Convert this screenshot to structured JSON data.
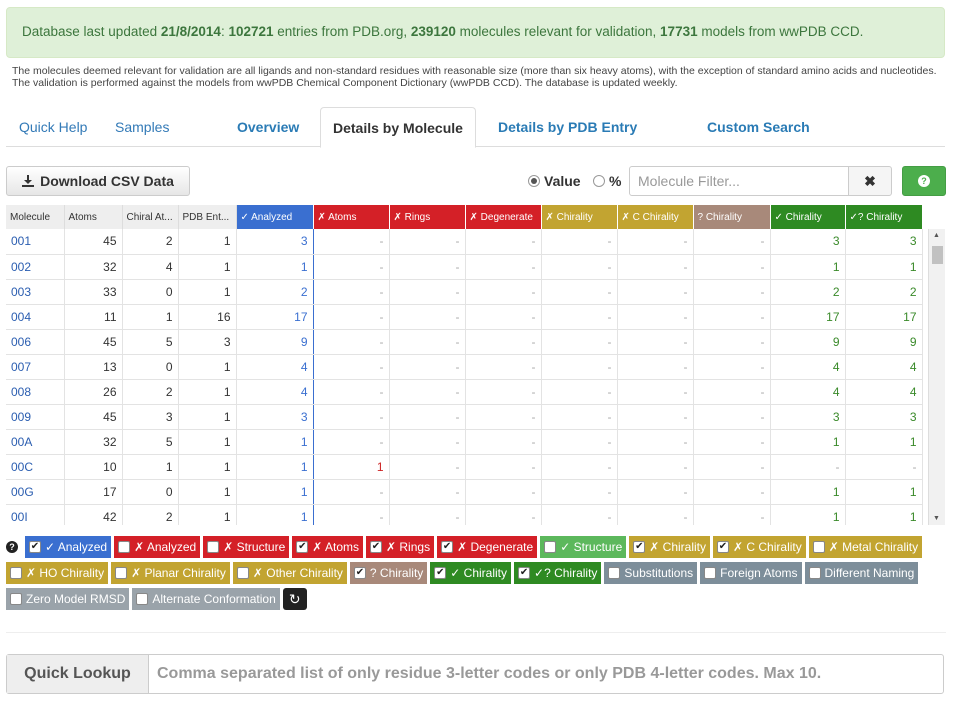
{
  "banner": {
    "prefix": "Database last updated",
    "date": "21/8/2014",
    "entries": "102721",
    "entries_text": "entries from PDB.org,",
    "molecules": "239120",
    "molecules_text": "molecules relevant for validation,",
    "models": "17731",
    "models_text": "models from wwPDB CCD."
  },
  "note": "The molecules deemed relevant for validation are all ligands and non-standard residues with reasonable size (more than six heavy atoms), with the exception of standard amino acids and nucleotides. The validation is performed against the models from wwPDB Chemical Component Dictionary (wwPDB CCD). The database is updated weekly.",
  "tabs": [
    "Quick Help",
    "Samples",
    "Overview",
    "Details by Molecule",
    "Details by PDB Entry",
    "Custom Search"
  ],
  "toolbar": {
    "download_label": "Download CSV Data",
    "value_label": "Value",
    "percent_label": "%",
    "filter_placeholder": "Molecule Filter..."
  },
  "colors": {
    "analyzed": "#3a6fd0",
    "red": "#d42027",
    "gold": "#c2a431",
    "brown": "#a8897a",
    "green": "#2e8a22",
    "slate": "#7d8e9a"
  },
  "columns": [
    {
      "label": "Molecule",
      "style": "plain"
    },
    {
      "label": "Atoms",
      "style": "plain"
    },
    {
      "label": "Chiral At...",
      "style": "plain"
    },
    {
      "label": "PDB Ent...",
      "style": "plain"
    },
    {
      "label": "✓ Analyzed",
      "style": "analyzed"
    },
    {
      "label": "✗ Atoms",
      "style": "red"
    },
    {
      "label": "✗ Rings",
      "style": "red"
    },
    {
      "label": "✗ Degenerate",
      "style": "red"
    },
    {
      "label": "✗ Chirality",
      "style": "gold"
    },
    {
      "label": "✗ C Chirality",
      "style": "gold"
    },
    {
      "label": "? Chirality",
      "style": "brown"
    },
    {
      "label": "✓ Chirality",
      "style": "green"
    },
    {
      "label": "✓? Chirality",
      "style": "green"
    }
  ],
  "rows": [
    [
      "001",
      "45",
      "2",
      "1",
      "3",
      "-",
      "-",
      "-",
      "-",
      "-",
      "-",
      "3",
      "3"
    ],
    [
      "002",
      "32",
      "4",
      "1",
      "1",
      "-",
      "-",
      "-",
      "-",
      "-",
      "-",
      "1",
      "1"
    ],
    [
      "003",
      "33",
      "0",
      "1",
      "2",
      "-",
      "-",
      "-",
      "-",
      "-",
      "-",
      "2",
      "2"
    ],
    [
      "004",
      "11",
      "1",
      "16",
      "17",
      "-",
      "-",
      "-",
      "-",
      "-",
      "-",
      "17",
      "17"
    ],
    [
      "006",
      "45",
      "5",
      "3",
      "9",
      "-",
      "-",
      "-",
      "-",
      "-",
      "-",
      "9",
      "9"
    ],
    [
      "007",
      "13",
      "0",
      "1",
      "4",
      "-",
      "-",
      "-",
      "-",
      "-",
      "-",
      "4",
      "4"
    ],
    [
      "008",
      "26",
      "2",
      "1",
      "4",
      "-",
      "-",
      "-",
      "-",
      "-",
      "-",
      "4",
      "4"
    ],
    [
      "009",
      "45",
      "3",
      "1",
      "3",
      "-",
      "-",
      "-",
      "-",
      "-",
      "-",
      "3",
      "3"
    ],
    [
      "00A",
      "32",
      "5",
      "1",
      "1",
      "-",
      "-",
      "-",
      "-",
      "-",
      "-",
      "1",
      "1"
    ],
    [
      "00C",
      "10",
      "1",
      "1",
      "1",
      "1",
      "-",
      "-",
      "-",
      "-",
      "-",
      "-",
      "-"
    ],
    [
      "00G",
      "17",
      "0",
      "1",
      "1",
      "-",
      "-",
      "-",
      "-",
      "-",
      "-",
      "1",
      "1"
    ],
    [
      "00I",
      "42",
      "2",
      "1",
      "1",
      "-",
      "-",
      "-",
      "-",
      "-",
      "-",
      "1",
      "1"
    ]
  ],
  "legend": [
    [
      {
        "label": "✓ Analyzed",
        "color": "#3a6fd0",
        "checked": true
      },
      {
        "label": "✗ Analyzed",
        "color": "#d42027",
        "checked": false
      },
      {
        "label": "✗ Structure",
        "color": "#d42027",
        "checked": false
      },
      {
        "label": "✗ Atoms",
        "color": "#d42027",
        "checked": true
      },
      {
        "label": "✗ Rings",
        "color": "#d42027",
        "checked": true
      },
      {
        "label": "✗ Degenerate",
        "color": "#d42027",
        "checked": true
      },
      {
        "label": "✓ Structure",
        "color": "#5cb85c",
        "checked": false
      },
      {
        "label": "✗ Chirality",
        "color": "#c2a431",
        "checked": true
      },
      {
        "label": "✗ C Chirality",
        "color": "#c2a431",
        "checked": true
      },
      {
        "label": "✗ Metal Chirality",
        "color": "#c2a431",
        "checked": false
      }
    ],
    [
      {
        "label": "✗ HO Chirality",
        "color": "#c2a431",
        "checked": false
      },
      {
        "label": "✗ Planar Chirality",
        "color": "#c2a431",
        "checked": false
      },
      {
        "label": "✗ Other Chirality",
        "color": "#c2a431",
        "checked": false
      },
      {
        "label": "? Chirality",
        "color": "#a8897a",
        "checked": true
      },
      {
        "label": "✓ Chirality",
        "color": "#2e8a22",
        "checked": true
      },
      {
        "label": "✓? Chirality",
        "color": "#2e8a22",
        "checked": true
      },
      {
        "label": "Substitutions",
        "color": "#7d8e9a",
        "checked": false
      },
      {
        "label": "Foreign Atoms",
        "color": "#7d8e9a",
        "checked": false
      },
      {
        "label": "Different Naming",
        "color": "#7d8e9a",
        "checked": false
      }
    ],
    [
      {
        "label": "Zero Model RMSD",
        "color": "#9aa3aa",
        "checked": false
      },
      {
        "label": "Alternate Conformation",
        "color": "#9aa3aa",
        "checked": false
      }
    ]
  ],
  "lookup": {
    "label": "Quick Lookup",
    "placeholder": "Comma separated list of only residue 3-letter codes or only PDB 4-letter codes. Max 10."
  }
}
